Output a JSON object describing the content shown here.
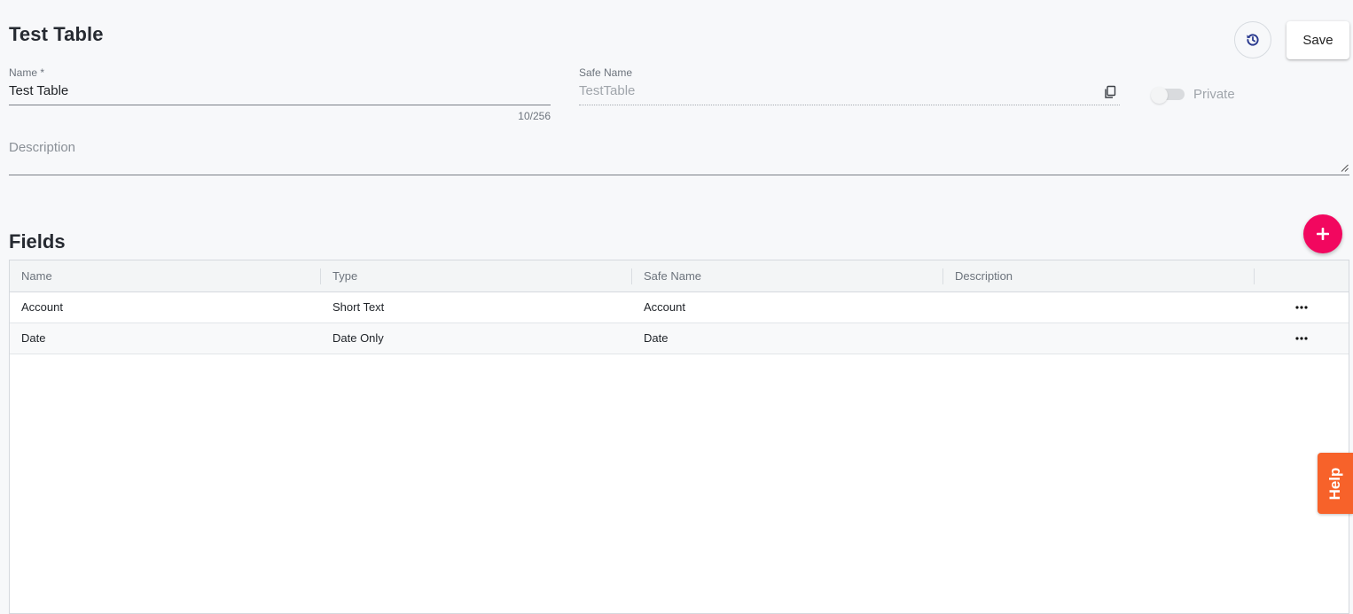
{
  "page": {
    "title": "Test Table"
  },
  "toolbar": {
    "history_icon": "history-icon",
    "save_label": "Save"
  },
  "form": {
    "name": {
      "label": "Name *",
      "value": "Test Table",
      "counter": "10/256"
    },
    "safe_name": {
      "label": "Safe Name",
      "value": "TestTable",
      "copy_icon": "copy-icon"
    },
    "private_toggle": {
      "label": "Private",
      "checked": false
    },
    "description": {
      "placeholder": "Description"
    }
  },
  "fields": {
    "title": "Fields",
    "add_icon": "plus-icon",
    "add_color": "#f2075f",
    "columns": [
      "Name",
      "Type",
      "Safe Name",
      "Description"
    ],
    "rows": [
      {
        "name": "Account",
        "type": "Short Text",
        "safe_name": "Account",
        "description": ""
      },
      {
        "name": "Date",
        "type": "Date Only",
        "safe_name": "Date",
        "description": ""
      }
    ],
    "row_menu_icon": "more-horizontal-icon"
  },
  "help": {
    "label": "Help",
    "color": "#f7622a"
  }
}
